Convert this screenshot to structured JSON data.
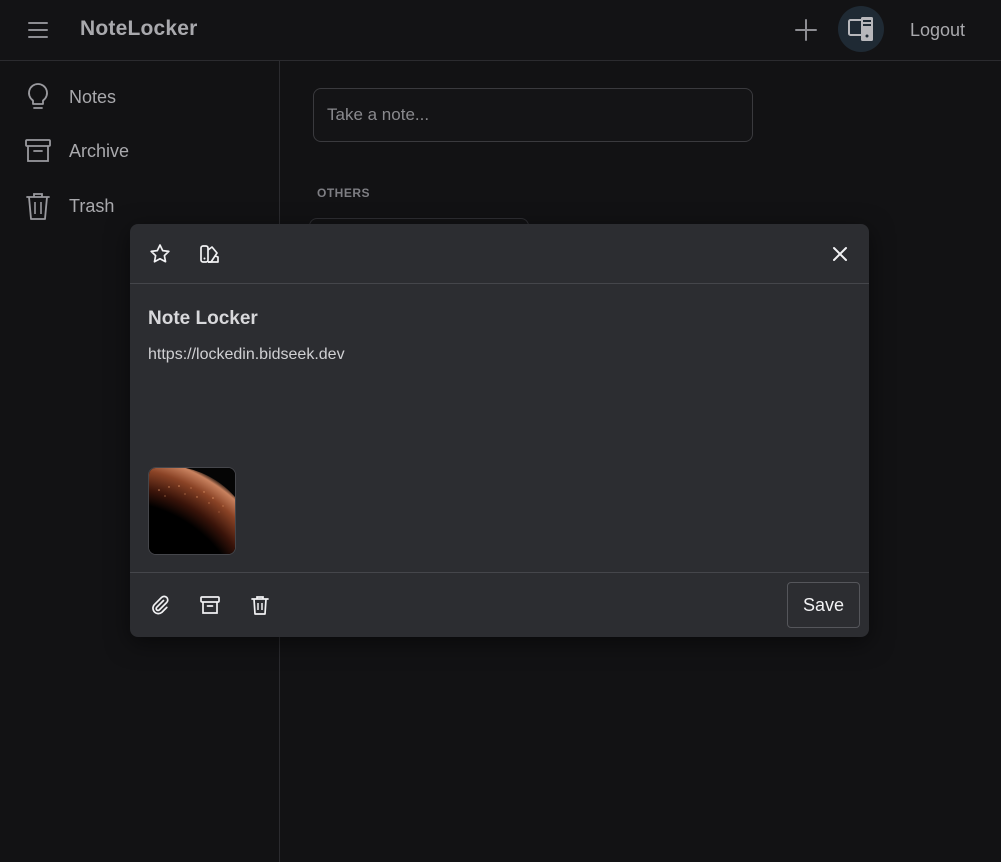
{
  "header": {
    "brand": "NoteLocker",
    "logout_label": "Logout",
    "icons": [
      "hamburger-menu-icon",
      "plus-icon",
      "device-icon"
    ]
  },
  "sidebar": {
    "items": [
      {
        "label": "Notes",
        "icon": "lightbulb-icon"
      },
      {
        "label": "Archive",
        "icon": "archive-icon"
      },
      {
        "label": "Trash",
        "icon": "trash-icon"
      }
    ]
  },
  "main": {
    "take_note_placeholder": "Take a note...",
    "section_label": "OTHERS"
  },
  "modal": {
    "title": "Note Locker",
    "body": "https://lockedin.bidseek.dev",
    "save_label": "Save",
    "top_icons": [
      "star-icon",
      "color-palette-icon",
      "close-icon"
    ],
    "bottom_icons": [
      "attachment-icon",
      "archive-icon",
      "trash-icon"
    ],
    "attachment": "planet-image-thumbnail"
  },
  "colors": {
    "background": "#121214",
    "modal": "#2c2d31",
    "text": "#a9a9ad",
    "accent_circle": "#1f2a34"
  }
}
